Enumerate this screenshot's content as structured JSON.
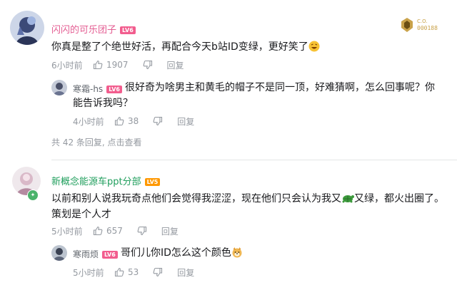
{
  "colors": {
    "username_pink": "#e45e93",
    "username_green": "#1f9e5c",
    "level_red": "#f25d8e",
    "level_orange": "#ff9800",
    "meta_gray": "#9499a0",
    "text_dark": "#18191c"
  },
  "comments": [
    {
      "username": "闪闪的可乐团子",
      "level": "LV6",
      "badge_text": "000188",
      "content": "你真是整了个绝世好活，再配合今天b站ID变绿，更好笑了",
      "time": "6小时前",
      "likes": "1907",
      "reply_label": "回复",
      "replies": [
        {
          "username": "寒霜-hs",
          "level": "LV6",
          "content": "很好奇为啥男主和黄毛的帽子不是同一顶，好难猜啊，怎么回事呢？你能告诉我吗？",
          "time": "4小时前",
          "likes": "38",
          "reply_label": "回复"
        }
      ],
      "summary_count": "共 42 条回复,",
      "summary_link": "点击查看"
    },
    {
      "username": "新概念能源车ppt分部",
      "level": "LV5",
      "content_before": "以前和别人说我玩奇点他们会觉得我涩涩，现在他们只会认为我又",
      "content_after": "又绿，都火出圈了。策划是个人才",
      "time": "5小时前",
      "likes": "657",
      "reply_label": "回复",
      "replies": [
        {
          "username": "寒雨烦",
          "level": "LV6",
          "content": "哥们儿你ID怎么这个颜色",
          "time": "5小时前",
          "likes": "53",
          "reply_label": "回复"
        }
      ]
    }
  ]
}
